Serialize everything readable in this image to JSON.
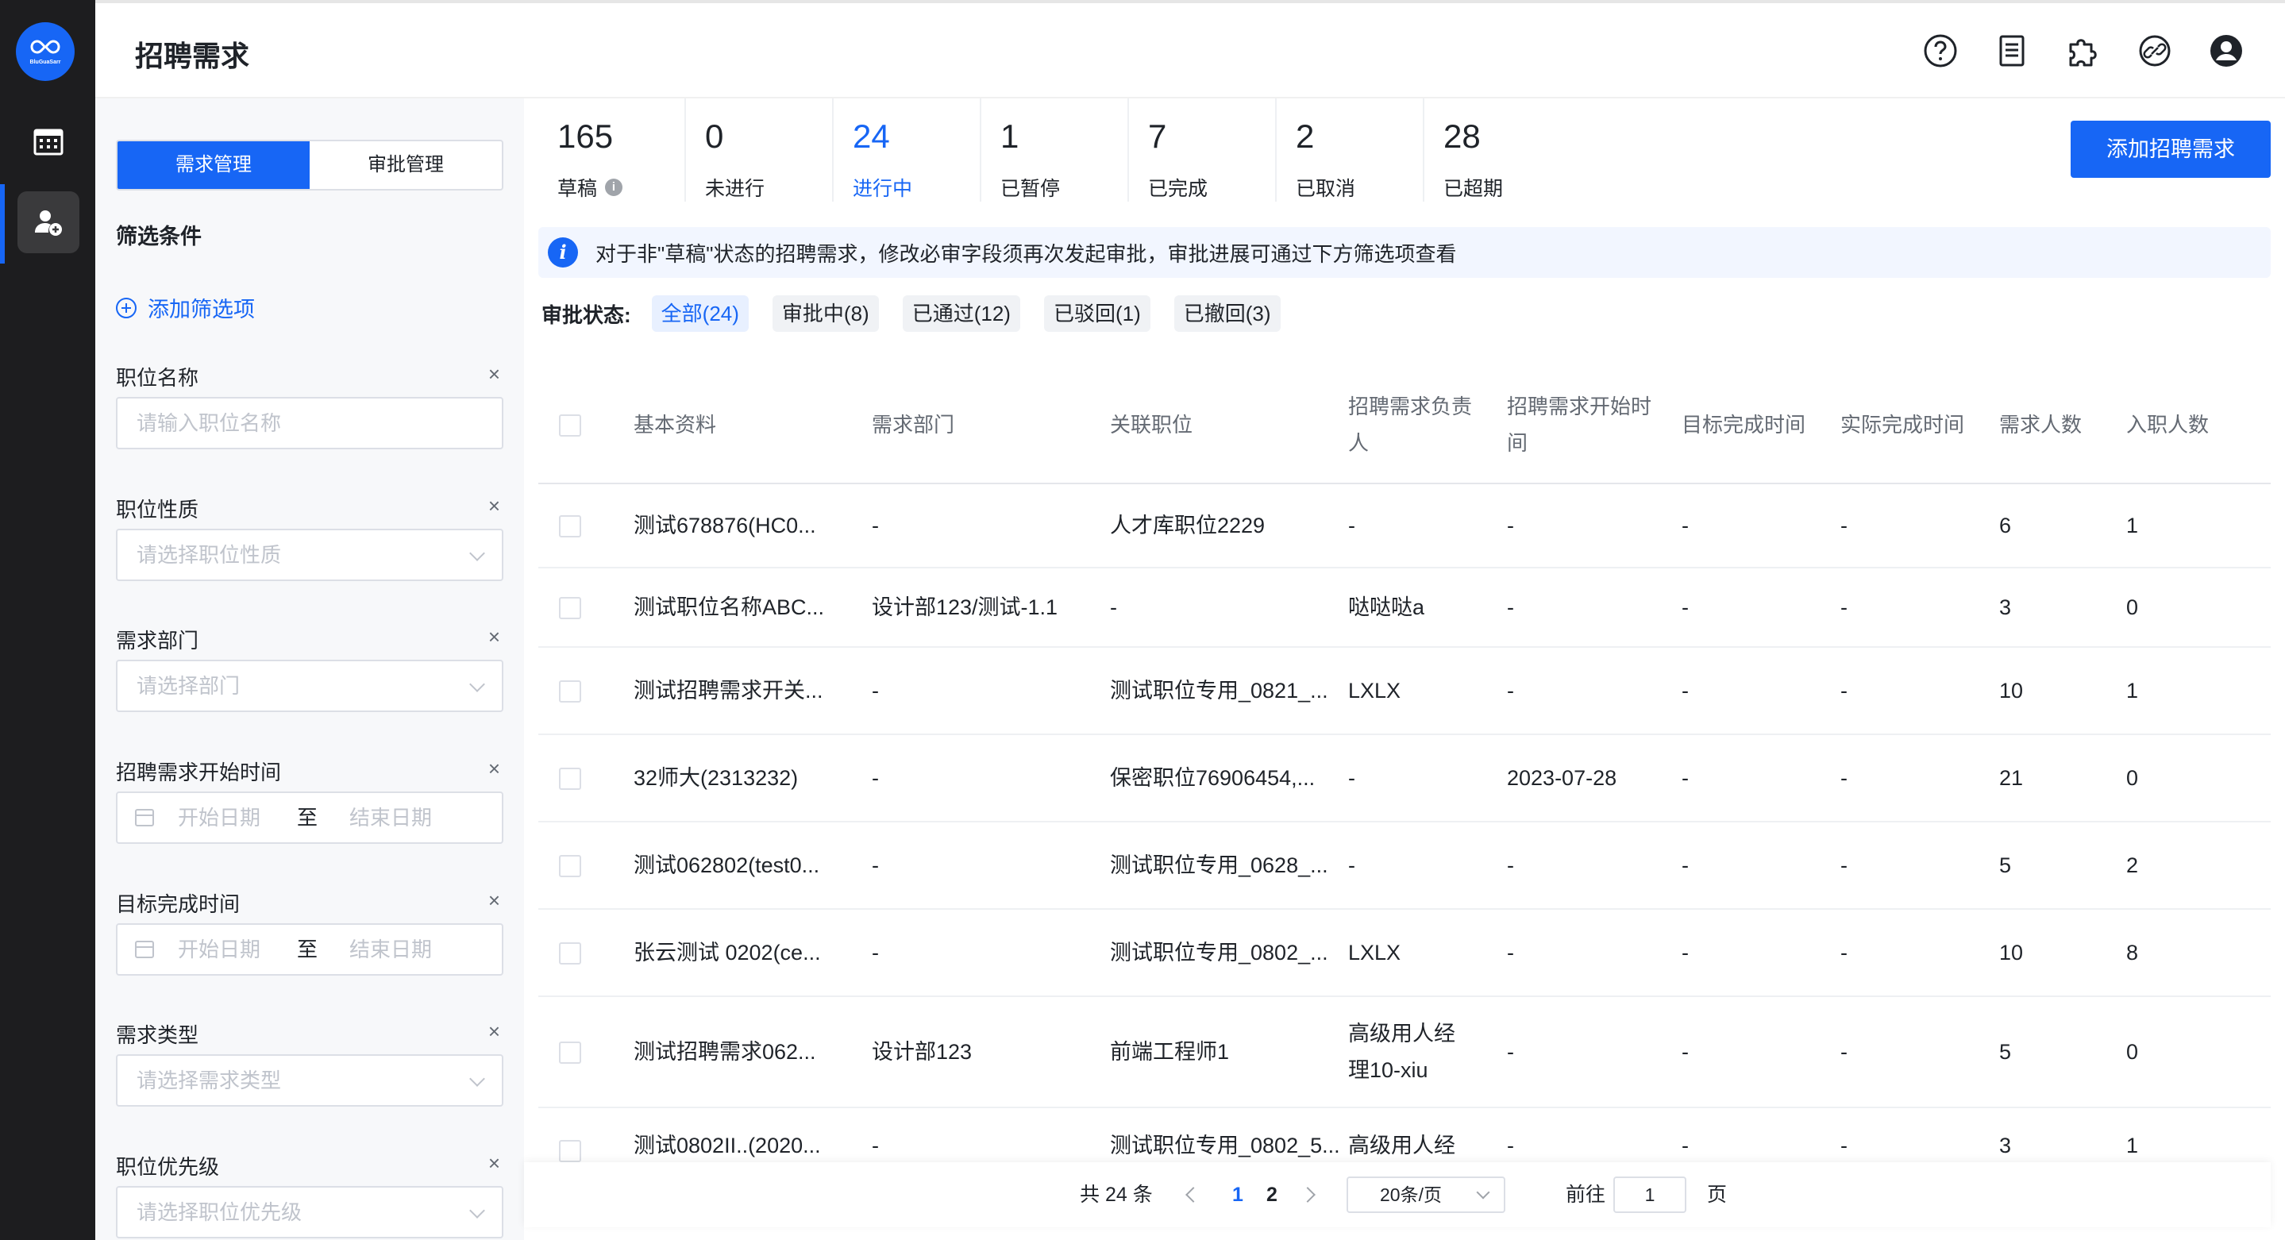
{
  "app": {
    "logo_text": "BluGuaSarr",
    "title": "招聘需求"
  },
  "header_icons": [
    "help-icon",
    "document-icon",
    "puzzle-icon",
    "link-icon",
    "user-icon"
  ],
  "filter": {
    "tabs": [
      "需求管理",
      "审批管理"
    ],
    "title": "筛选条件",
    "add_label": "添加筛选项",
    "fields": [
      {
        "label": "职位名称",
        "placeholder": "请输入职位名称",
        "type": "text"
      },
      {
        "label": "职位性质",
        "placeholder": "请选择职位性质",
        "type": "select"
      },
      {
        "label": "需求部门",
        "placeholder": "请选择部门",
        "type": "select"
      },
      {
        "label": "招聘需求开始时间",
        "start": "开始日期",
        "sep": "至",
        "end": "结束日期",
        "type": "range"
      },
      {
        "label": "目标完成时间",
        "start": "开始日期",
        "sep": "至",
        "end": "结束日期",
        "type": "range"
      },
      {
        "label": "需求类型",
        "placeholder": "请选择需求类型",
        "type": "select"
      },
      {
        "label": "职位优先级",
        "placeholder": "请选择职位优先级",
        "type": "select"
      }
    ],
    "close_glyph": "×"
  },
  "stats": [
    {
      "num": "165",
      "label": "草稿",
      "info": true
    },
    {
      "num": "0",
      "label": "未进行"
    },
    {
      "num": "24",
      "label": "进行中",
      "active": true
    },
    {
      "num": "1",
      "label": "已暂停"
    },
    {
      "num": "7",
      "label": "已完成"
    },
    {
      "num": "2",
      "label": "已取消"
    },
    {
      "num": "28",
      "label": "已超期"
    }
  ],
  "add_button": "添加招聘需求",
  "notice": {
    "icon": "i",
    "text": "对于非\"草稿\"状态的招聘需求，修改必审字段须再次发起审批，审批进展可通过下方筛选项查看"
  },
  "approval": {
    "label": "审批状态:",
    "chips": [
      "全部(24)",
      "审批中(8)",
      "已通过(12)",
      "已驳回(1)",
      "已撤回(3)"
    ]
  },
  "table": {
    "headers": [
      "基本资料",
      "需求部门",
      "关联职位",
      "招聘需求负责人",
      "招聘需求开始时间",
      "目标完成时间",
      "实际完成时间",
      "需求人数",
      "入职人数"
    ],
    "rows": [
      [
        "测试678876(HC0...",
        "-",
        "人才库职位2229",
        "-",
        "-",
        "-",
        "-",
        "6",
        "1"
      ],
      [
        "测试职位名称ABC...",
        "设计部123/测试-1.1",
        "-",
        "哒哒哒a",
        "-",
        "-",
        "-",
        "3",
        "0"
      ],
      [
        "测试招聘需求开关...",
        "-",
        "测试职位专用_0821_...",
        "LXLX",
        "-",
        "-",
        "-",
        "10",
        "1"
      ],
      [
        "32师大(2313232)",
        "-",
        "保密职位76906454,...",
        "-",
        "2023-07-28",
        "-",
        "-",
        "21",
        "0"
      ],
      [
        "测试062802(test0...",
        "-",
        "测试职位专用_0628_...",
        "-",
        "-",
        "-",
        "-",
        "5",
        "2"
      ],
      [
        "张云测试 0202(ce...",
        "-",
        "测试职位专用_0802_...",
        "LXLX",
        "-",
        "-",
        "-",
        "10",
        "8"
      ],
      [
        "测试招聘需求062...",
        "设计部123",
        "前端工程师1",
        "高级用人经理10-xiu",
        "-",
        "-",
        "-",
        "5",
        "0"
      ],
      [
        "测试0802II..(2020...",
        "-",
        "测试职位专用_0802_5...",
        "高级用人经",
        "-",
        "-",
        "-",
        "3",
        "1"
      ]
    ]
  },
  "pagination": {
    "total": "共 24 条",
    "pages": [
      "1",
      "2"
    ],
    "current": "1",
    "page_size": "20条/页",
    "goto_label": "前往",
    "goto_value": "1",
    "page_unit": "页"
  }
}
